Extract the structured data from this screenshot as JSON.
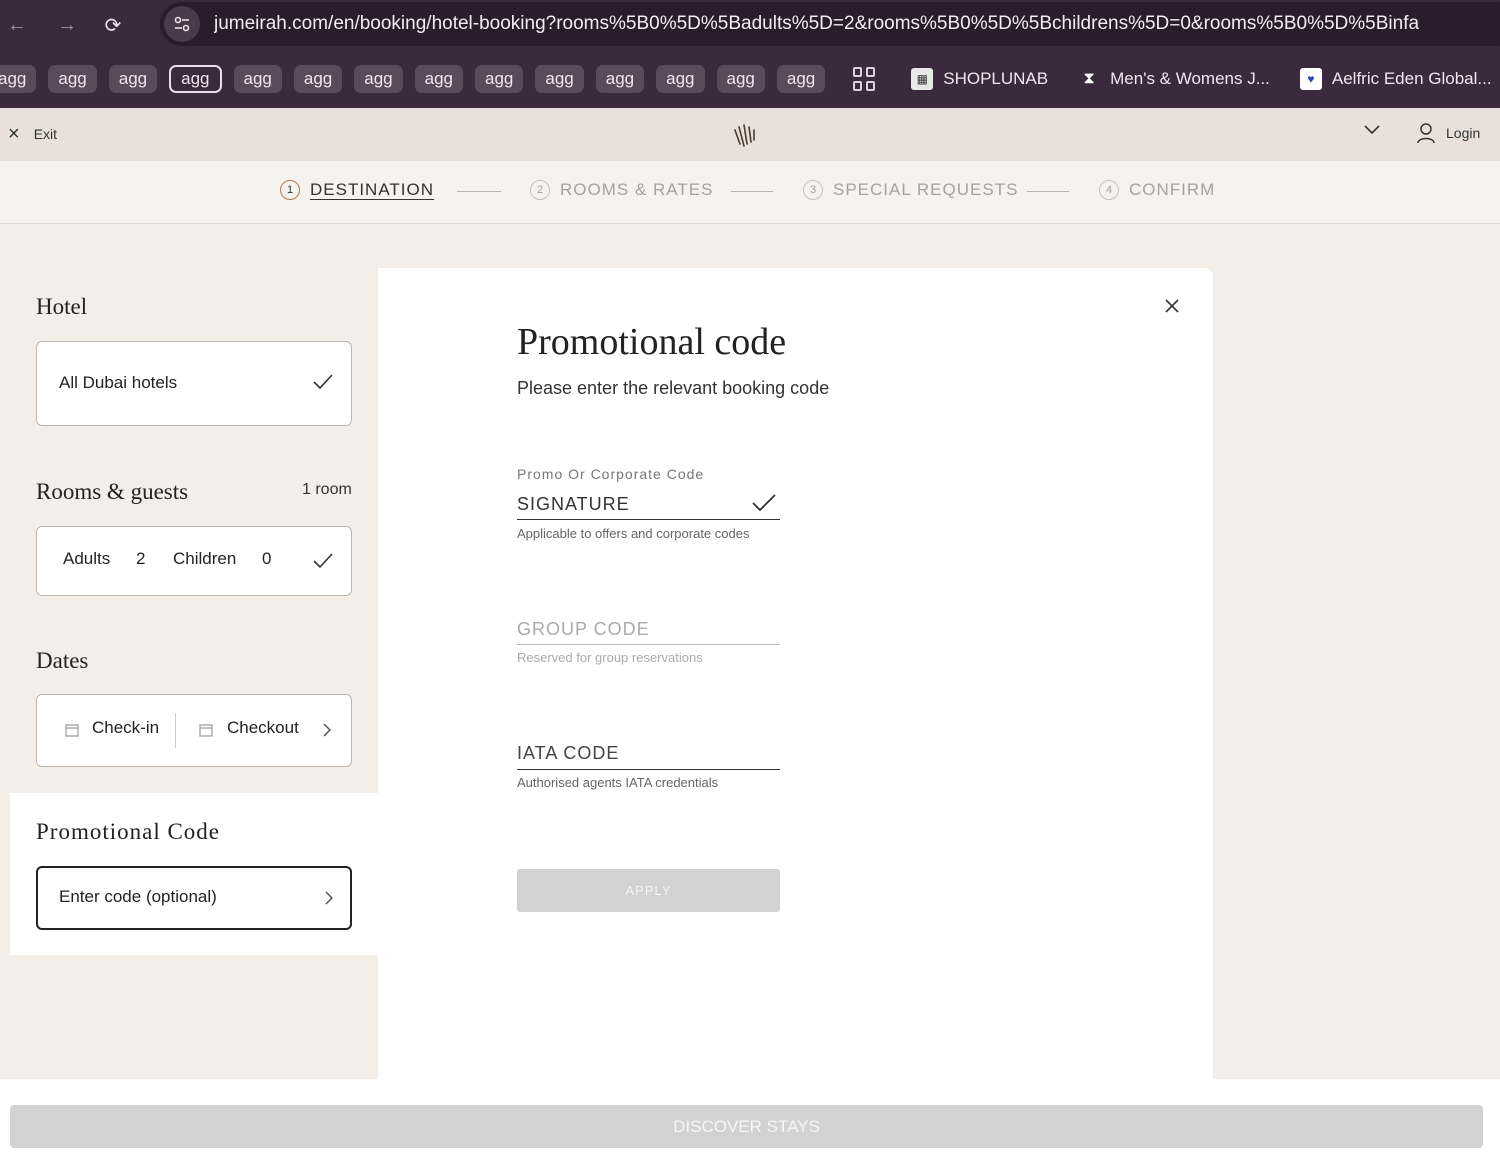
{
  "browser": {
    "url": "jumeirah.com/en/booking/hotel-booking?rooms%5B0%5D%5Badults%5D=2&rooms%5B0%5D%5Bchildrens%5D=0&rooms%5B0%5D%5Binfa",
    "bookmark_tags": [
      "agg",
      "agg",
      "agg",
      "agg",
      "agg",
      "agg",
      "agg",
      "agg",
      "agg",
      "agg",
      "agg",
      "agg",
      "agg",
      "agg"
    ],
    "bookmarks": [
      "SHOPLUNAB",
      "Men's & Womens J...",
      "Aelfric Eden Global..."
    ]
  },
  "header": {
    "exit_label": "Exit",
    "login_label": "Login"
  },
  "steps": [
    {
      "num": "1",
      "label": "DESTINATION"
    },
    {
      "num": "2",
      "label": "ROOMS & RATES"
    },
    {
      "num": "3",
      "label": "SPECIAL REQUESTS"
    },
    {
      "num": "4",
      "label": "CONFIRM"
    }
  ],
  "sidebar": {
    "hotel_title": "Hotel",
    "hotel_value": "All Dubai hotels",
    "rooms_title": "Rooms & guests",
    "room_count": "1 room",
    "adults_label": "Adults",
    "adults_value": "2",
    "children_label": "Children",
    "children_value": "0",
    "dates_title": "Dates",
    "checkin_label": "Check-in",
    "checkout_label": "Checkout",
    "promo_title": "Promotional Code",
    "promo_placeholder": "Enter code (optional)"
  },
  "modal": {
    "title": "Promotional code",
    "subtitle": "Please enter the relevant booking code",
    "promo_label": "Promo Or Corporate Code",
    "promo_value": "SIGNATURE",
    "promo_help": "Applicable to offers and corporate codes",
    "group_placeholder": "GROUP CODE",
    "group_help": "Reserved for group reservations",
    "iata_placeholder": "IATA CODE",
    "iata_help": "Authorised agents IATA credentials",
    "apply_label": "APPLY"
  },
  "footer": {
    "discover_label": "DISCOVER STAYS"
  }
}
